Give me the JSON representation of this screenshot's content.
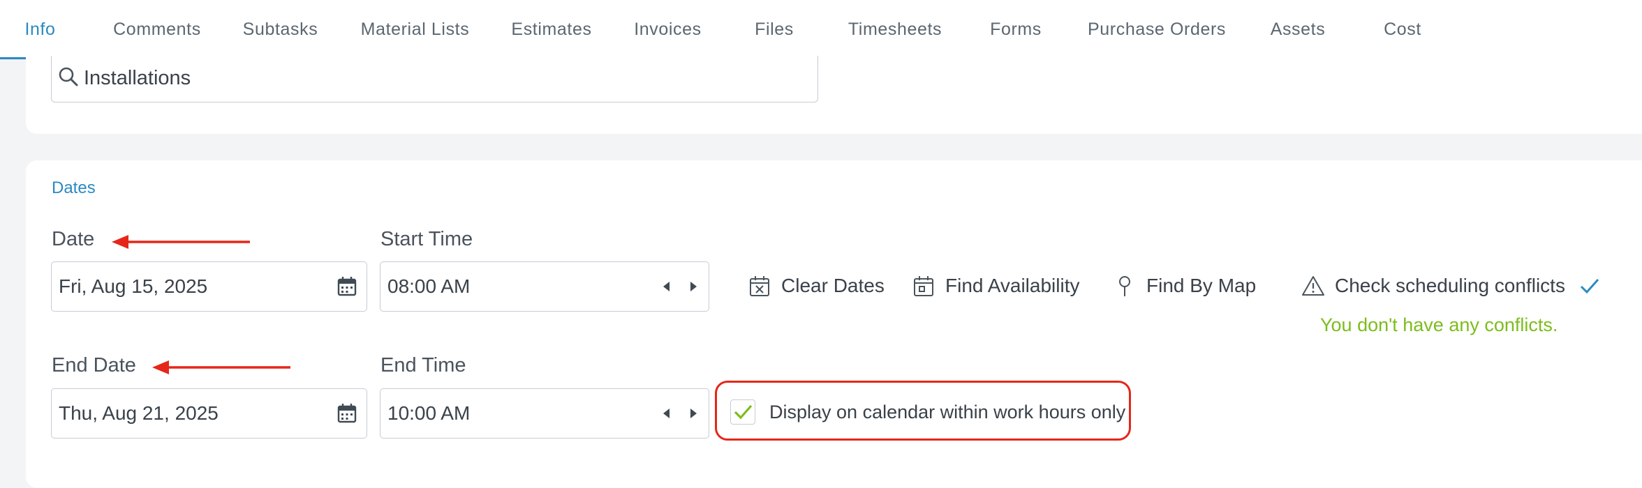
{
  "tabs": [
    {
      "label": "Info",
      "active": true
    },
    {
      "label": "Comments"
    },
    {
      "label": "Subtasks"
    },
    {
      "label": "Material Lists"
    },
    {
      "label": "Estimates"
    },
    {
      "label": "Invoices"
    },
    {
      "label": "Files"
    },
    {
      "label": "Timesheets"
    },
    {
      "label": "Forms"
    },
    {
      "label": "Purchase Orders"
    },
    {
      "label": "Assets"
    },
    {
      "label": "Cost"
    }
  ],
  "category_search": {
    "value": "Installations",
    "icon": "search-icon"
  },
  "dates": {
    "section_title": "Dates",
    "date_label": "Date",
    "date_value": "Fri, Aug 15, 2025",
    "start_time_label": "Start Time",
    "start_time_value": "08:00 AM",
    "end_date_label": "End Date",
    "end_date_value": "Thu, Aug 21, 2025",
    "end_time_label": "End Time",
    "end_time_value": "10:00 AM",
    "actions": {
      "clear_dates": "Clear Dates",
      "find_availability": "Find Availability",
      "find_by_map": "Find By Map",
      "check_conflicts": "Check scheduling conflicts"
    },
    "conflicts_message": "You don't have any conflicts.",
    "work_hours_checkbox": {
      "label": "Display on calendar within work hours only",
      "checked": true
    }
  },
  "colors": {
    "accent": "#2b8ac2",
    "success": "#7cbd1c",
    "annotation": "#e5271a"
  }
}
